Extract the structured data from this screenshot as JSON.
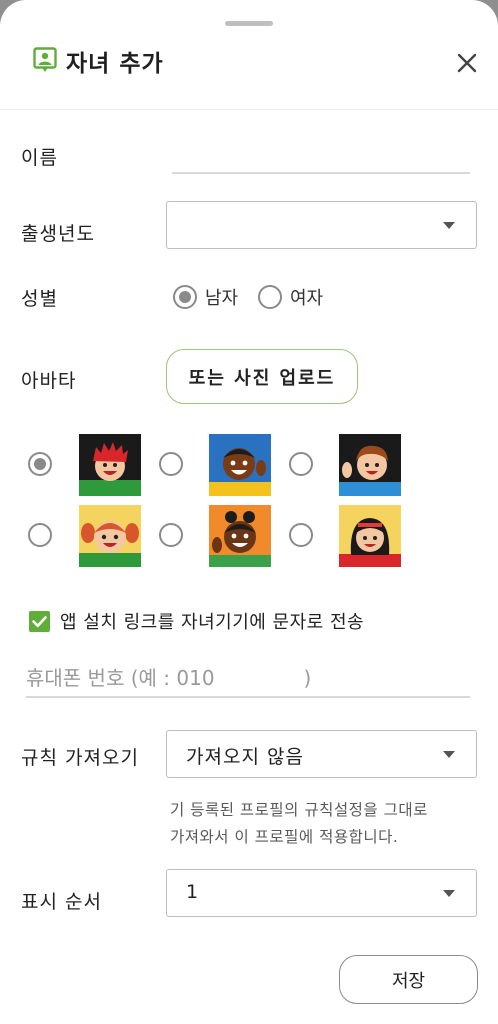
{
  "dialog": {
    "title": "자녀 추가",
    "accent_color": "#5fae3a"
  },
  "form": {
    "name_label": "이름",
    "name_value": "",
    "birth_year_label": "출생년도",
    "birth_year_value": "",
    "gender_label": "성별",
    "gender_options": [
      "남자",
      "여자"
    ],
    "gender_selected": "남자",
    "avatar_label": "아바타",
    "upload_button": "또는 사진 업로드",
    "avatars": [
      "red-hair-boy",
      "dark-skin-boy-waving",
      "brown-hair-boy-waving",
      "red-hair-girl",
      "dark-skin-girl-waving",
      "black-hair-girl"
    ],
    "avatar_selected_index": 0,
    "sms_checkbox_label": "앱 설치 링크를 자녀기기에 문자로 전송",
    "sms_checked": true,
    "phone_placeholder": "휴대폰 번호 (예 : 010              )",
    "rules_label": "규칙 가져오기",
    "rules_value": "가져오지 않음",
    "rules_hint_line1": "기 등록된 프로필의 규칙설정을 그대로",
    "rules_hint_line2": "가져와서 이 프로필에 적용합니다.",
    "order_label": "표시 순서",
    "order_value": "1",
    "save_button": "저장"
  }
}
